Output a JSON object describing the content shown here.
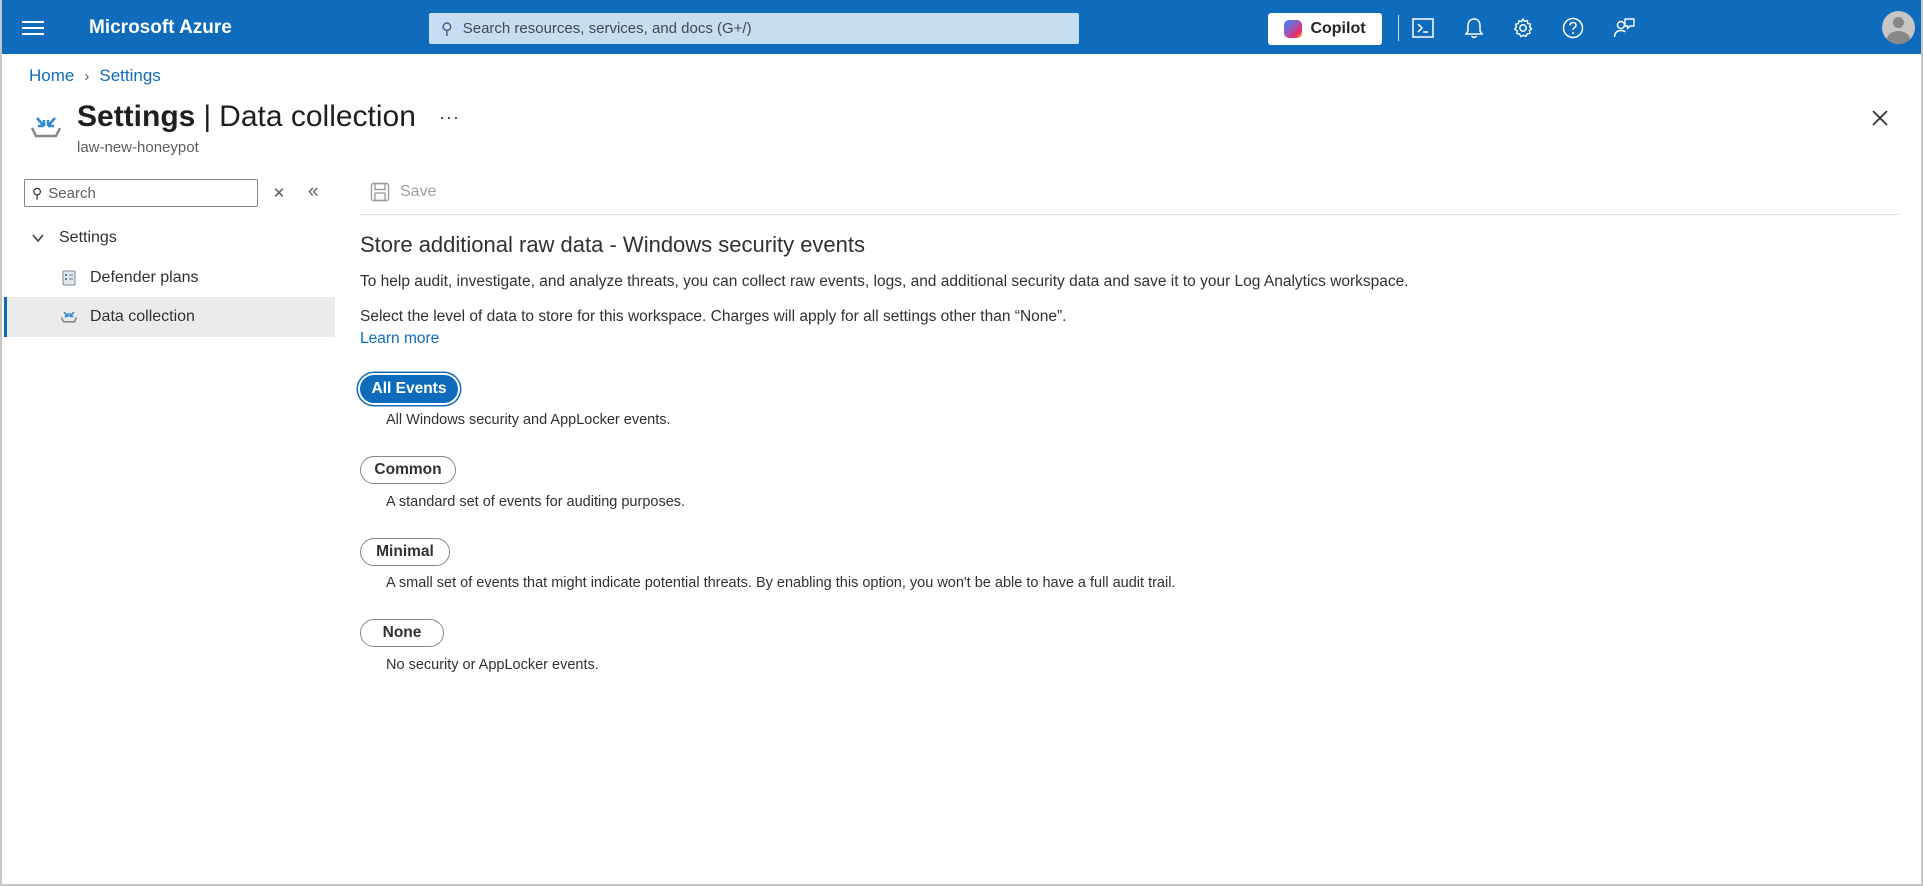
{
  "topbar": {
    "brand": "Microsoft Azure",
    "search_placeholder": "Search resources, services, and docs (G+/)",
    "copilot_label": "Copilot",
    "icons": [
      "cloud-shell-icon",
      "bell-icon",
      "gear-icon",
      "help-icon",
      "feedback-icon"
    ]
  },
  "breadcrumb": {
    "home": "Home",
    "settings": "Settings"
  },
  "header": {
    "title_main": "Settings",
    "title_separator": "|",
    "title_sub": "Data collection",
    "more": "···",
    "resource_name": "law-new-honeypot"
  },
  "nav": {
    "search_placeholder": "Search",
    "group_label": "Settings",
    "items": [
      {
        "label": "Defender plans"
      },
      {
        "label": "Data collection"
      }
    ]
  },
  "toolbar": {
    "save_label": "Save"
  },
  "main": {
    "heading": "Store additional raw data - Windows security events",
    "description": "To help audit, investigate, and analyze threats, you can collect raw events, logs, and additional security data and save it to your Log Analytics workspace.",
    "select_text": "Select the level of data to store for this workspace. Charges will apply for all settings other than “None”.",
    "learn_more": "Learn more",
    "selected_option": "All Events",
    "options": [
      {
        "label": "All Events",
        "description": "All Windows security and AppLocker events."
      },
      {
        "label": "Common",
        "description": "A standard set of events for auditing purposes."
      },
      {
        "label": "Minimal",
        "description": "A small set of events that might indicate potential threats. By enabling this option, you won't be able to have a full audit trail."
      },
      {
        "label": "None",
        "description": "No security or AppLocker events."
      }
    ]
  },
  "colors": {
    "accent": "#0f6cbd",
    "search_bg": "#c7ddf2",
    "nav_selected_bg": "#edebe9"
  }
}
